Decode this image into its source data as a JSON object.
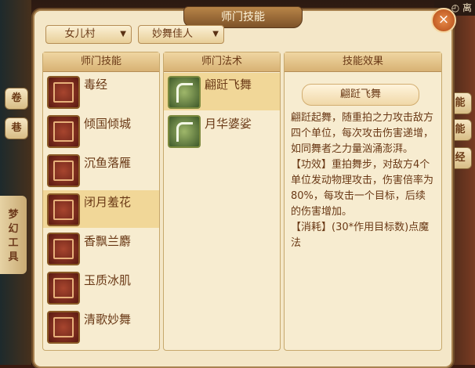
{
  "topbar": {
    "icon": "clock-icon",
    "label": "离"
  },
  "background": {
    "side_text": "梦幻工具",
    "left_buttons": [
      "巷",
      "卷"
    ],
    "right_buttons": [
      "能",
      "能",
      "经"
    ]
  },
  "dialog": {
    "title": "师门技能",
    "close_label": "×",
    "faction_dropdown": "女儿村",
    "category_dropdown": "妙舞佳人"
  },
  "skills_panel": {
    "header": "师门技能",
    "items": [
      {
        "label": "毒经"
      },
      {
        "label": "倾国倾城"
      },
      {
        "label": "沉鱼落雁"
      },
      {
        "label": "闭月羞花",
        "selected": true
      },
      {
        "label": "香飘兰麝"
      },
      {
        "label": "玉质冰肌"
      },
      {
        "label": "清歌妙舞"
      }
    ]
  },
  "magic_panel": {
    "header": "师门法术",
    "items": [
      {
        "label": "翩跹飞舞",
        "selected": true
      },
      {
        "label": "月华婆娑"
      }
    ]
  },
  "effect_panel": {
    "header": "技能效果",
    "skill_name": "翩跹飞舞",
    "description": "翩跹起舞，随重拍之力攻击敌方四个单位，每次攻击伤害递增，如同舞者之力量汹涌澎湃。",
    "effect": "【功效】重拍舞步，对敌方4个单位发动物理攻击，伤害倍率为80%，每攻击一个目标，后续的伤害增加。",
    "cost": "【消耗】(30*作用目标数)点魔法"
  },
  "colors": {
    "accent": "#6a3916",
    "selected_row": "#f1d798",
    "panel_bg": "#f7ecd0"
  }
}
